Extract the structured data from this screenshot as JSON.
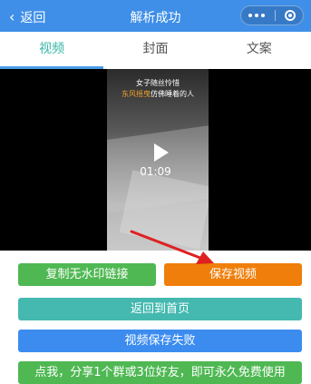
{
  "header": {
    "back_label": "返回",
    "title": "解析成功",
    "color": "#3f8fe8"
  },
  "tabs": [
    {
      "label": "视频",
      "active": true
    },
    {
      "label": "封面",
      "active": false
    },
    {
      "label": "文案",
      "active": false
    }
  ],
  "video": {
    "caption_line1": "女子随丝怜惜",
    "caption_line2_highlight": "东风摇曳",
    "caption_line2_rest": "仿佛睡着的人",
    "duration": "01:09"
  },
  "actions": {
    "copy_label": "复制无水印链接",
    "save_label": "保存视频",
    "home_label": "返回到首页",
    "status_label": "视频保存失败",
    "share_label": "点我，分享1个群或3位好友，即可永久免费使用"
  },
  "icons": {
    "back": "chevron-left-icon",
    "more": "more-dots-icon",
    "close": "target-icon",
    "play": "play-icon",
    "arrow": "red-arrow-annotation"
  }
}
